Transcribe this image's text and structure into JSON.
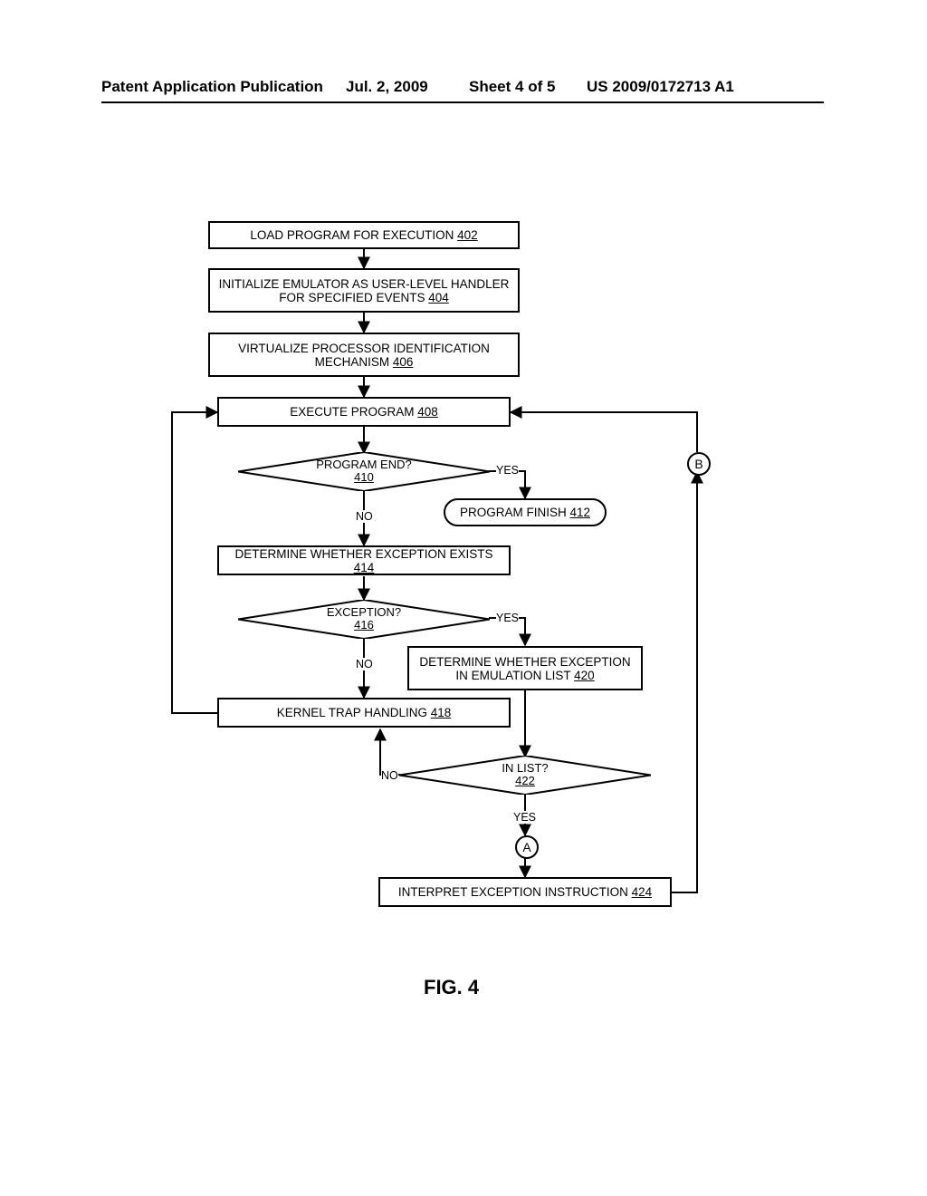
{
  "header": {
    "left": "Patent Application Publication",
    "date": "Jul. 2, 2009",
    "sheet": "Sheet 4 of 5",
    "pubno": "US 2009/0172713 A1"
  },
  "fig_caption": "FIG. 4",
  "nodes": {
    "n402": {
      "text": "LOAD PROGRAM FOR EXECUTION ",
      "ref": "402"
    },
    "n404": {
      "text": "INITIALIZE EMULATOR AS USER-LEVEL HANDLER FOR SPECIFIED EVENTS ",
      "ref": "404"
    },
    "n406": {
      "text": "VIRTUALIZE PROCESSOR IDENTIFICATION MECHANISM ",
      "ref": "406"
    },
    "n408": {
      "text": "EXECUTE PROGRAM ",
      "ref": "408"
    },
    "n410": {
      "text": "PROGRAM END?",
      "ref": "410"
    },
    "n412": {
      "text": "PROGRAM FINISH ",
      "ref": "412"
    },
    "n414": {
      "text": "DETERMINE WHETHER EXCEPTION EXISTS ",
      "ref": "414"
    },
    "n416": {
      "text": "EXCEPTION?",
      "ref": "416"
    },
    "n418": {
      "text": "KERNEL TRAP HANDLING ",
      "ref": "418"
    },
    "n420": {
      "text": "DETERMINE WHETHER EXCEPTION IN EMULATION LIST ",
      "ref": "420"
    },
    "n422": {
      "text": "IN LIST?",
      "ref": "422"
    },
    "n424": {
      "text": "INTERPRET EXCEPTION INSTRUCTION ",
      "ref": "424"
    }
  },
  "conn": {
    "A": "A",
    "B": "B"
  },
  "labels": {
    "yes": "YES",
    "no": "NO"
  }
}
